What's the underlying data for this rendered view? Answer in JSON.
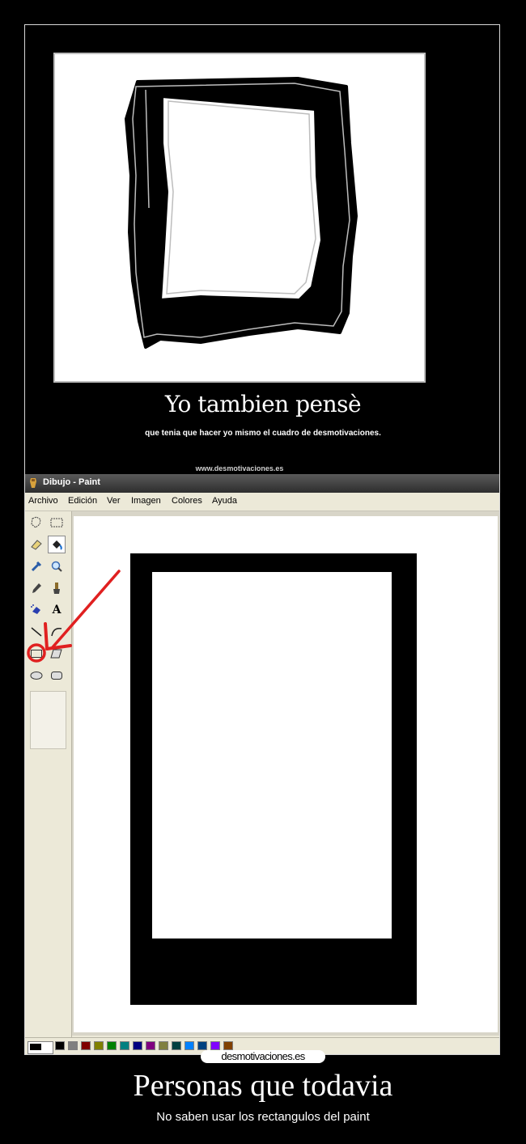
{
  "meme": {
    "title": "Yo tambien pensè",
    "subtitle": "que tenia que hacer yo mismo el cuadro de desmotivaciones.",
    "url": "www.desmotivaciones.es"
  },
  "paint": {
    "window_title": "Dibujo - Paint",
    "menu": [
      "Archivo",
      "Edición",
      "Ver",
      "Imagen",
      "Colores",
      "Ayuda"
    ],
    "palette_colors": [
      "#000000",
      "#808080",
      "#800000",
      "#808000",
      "#008000",
      "#008080",
      "#000080",
      "#800080",
      "#808040",
      "#004040",
      "#0080ff",
      "#004080",
      "#8000ff",
      "#804000"
    ],
    "annotation_color": "#e02020"
  },
  "watermark": "desmotivaciones.es",
  "caption": {
    "title": "Personas que todavia",
    "subtitle": "No saben usar los rectangulos del paint"
  }
}
